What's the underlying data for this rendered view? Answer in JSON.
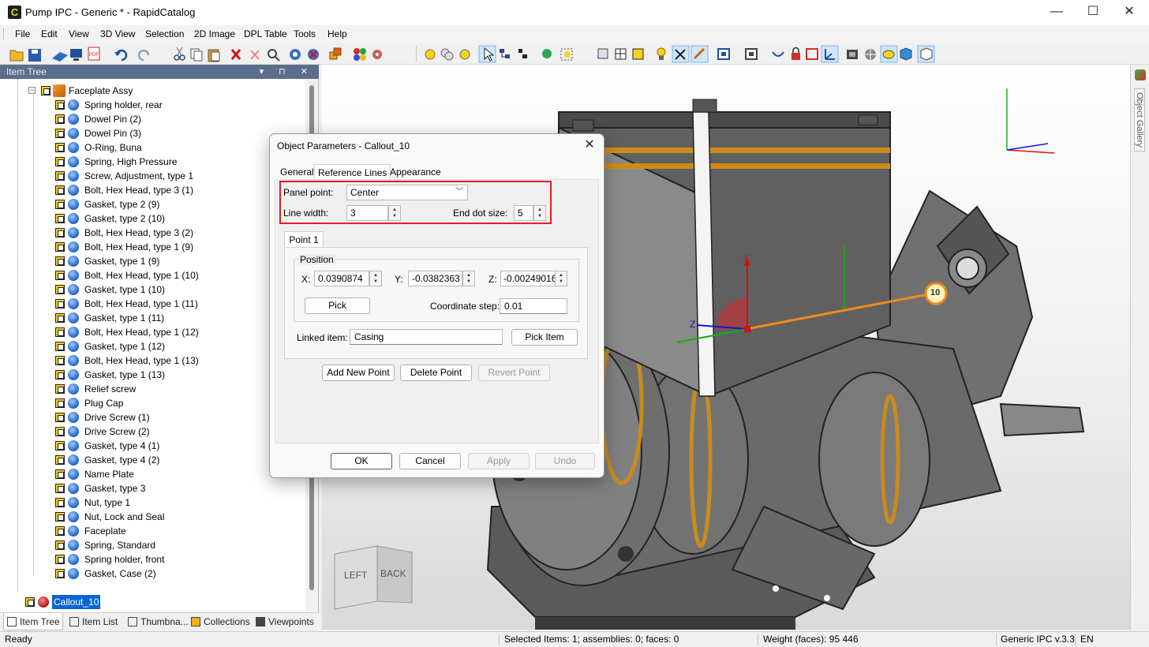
{
  "window": {
    "title": "Pump IPC - Generic * - RapidCatalog",
    "app_icon": "C",
    "min": "—",
    "max": "☐",
    "close": "✕"
  },
  "menu": [
    "File",
    "Edit",
    "View",
    "3D View",
    "Selection",
    "2D Image",
    "DPL Table",
    "Tools",
    "Help"
  ],
  "item_tree": {
    "header": "Item Tree",
    "root": "Faceplate Assy",
    "items": [
      "Spring holder, rear",
      "Dowel Pin (2)",
      "Dowel Pin (3)",
      "O-Ring, Buna",
      "Spring, High Pressure",
      "Screw, Adjustment, type 1",
      "Bolt, Hex Head, type 3 (1)",
      "Gasket, type 2 (9)",
      "Gasket, type 2 (10)",
      "Bolt, Hex Head, type 3 (2)",
      "Bolt, Hex Head, type 1 (9)",
      "Gasket, type 1 (9)",
      "Bolt, Hex Head, type 1 (10)",
      "Gasket, type 1 (10)",
      "Bolt, Hex Head, type 1 (11)",
      "Gasket, type 1 (11)",
      "Bolt, Hex Head, type 1 (12)",
      "Gasket, type 1 (12)",
      "Bolt, Hex Head, type 1 (13)",
      "Gasket, type 1 (13)",
      "Relief screw",
      "Plug Cap",
      "Drive Screw (1)",
      "Drive Screw (2)",
      "Gasket, type 4 (1)",
      "Gasket, type 4 (2)",
      "Name Plate",
      "Gasket, type 3",
      "Nut, type 1",
      "Nut, Lock and Seal",
      "Faceplate",
      "Spring, Standard",
      "Spring holder, front",
      "Gasket, Case (2)"
    ],
    "selected": "Callout_10"
  },
  "bottom_tabs": [
    "Item Tree",
    "Item List",
    "Thumbna...",
    "Collections",
    "Viewpoints"
  ],
  "viewport": {
    "callout_number": "10",
    "axis_x": "X",
    "axis_z": "Z",
    "viewcube_left": "LEFT",
    "viewcube_back": "BACK",
    "gallery_label": "Object Gallery"
  },
  "dialog": {
    "title": "Object Parameters - Callout_10",
    "tabs": [
      "General",
      "Reference Lines",
      "Appearance"
    ],
    "active_tab": "Reference Lines",
    "panel_point_label": "Panel point:",
    "panel_point_value": "Center",
    "line_width_label": "Line width:",
    "line_width_value": "3",
    "end_dot_label": "End dot size:",
    "end_dot_value": "5",
    "point_tab": "Point 1",
    "position_label": "Position",
    "x_label": "X:",
    "x_value": "0.0390874",
    "y_label": "Y:",
    "y_value": "-0.0382363",
    "z_label": "Z:",
    "z_value": "-0.00249016",
    "pick": "Pick",
    "coord_step_label": "Coordinate step:",
    "coord_step_value": "0.01",
    "linked_item_label": "Linked item:",
    "linked_item_value": "Casing",
    "pick_item": "Pick Item",
    "add_point": "Add New Point",
    "delete_point": "Delete Point",
    "revert_point": "Revert Point",
    "ok": "OK",
    "cancel": "Cancel",
    "apply": "Apply",
    "undo": "Undo"
  },
  "status": {
    "ready": "Ready",
    "selected": "Selected Items: 1; assemblies: 0; faces: 0",
    "weight": "Weight (faces): 95 446",
    "version": "Generic IPC v.3.3",
    "lang": "EN"
  },
  "colors": {
    "accent_selection": "#0a64d2",
    "highlight_box": "#e0202a",
    "callout_line": "#f08a1c",
    "panel_header": "#5b6e8c"
  }
}
